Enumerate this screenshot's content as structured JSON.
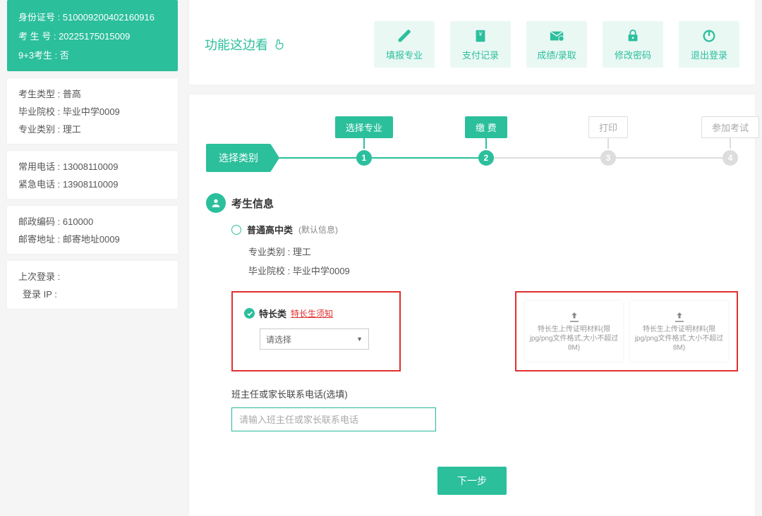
{
  "profile_card": {
    "id_label": "身份证号 :",
    "id_value": "510009200402160916",
    "exam_no_label": "考 生 号 :",
    "exam_no_value": "20225175015009",
    "nine_three_label": "9+3考生 :",
    "nine_three_value": "否"
  },
  "info1": {
    "type_label": "考生类型 :",
    "type_value": "普高",
    "school_label": "毕业院校 :",
    "school_value": "毕业中学0009",
    "cat_label": "专业类别 :",
    "cat_value": "理工"
  },
  "info2": {
    "phone_label": "常用电话 :",
    "phone_value": "13008110009",
    "emerg_label": "紧急电话 :",
    "emerg_value": "13908110009"
  },
  "info3": {
    "zip_label": "邮政编码 :",
    "zip_value": "610000",
    "addr_label": "邮寄地址 :",
    "addr_value": "邮寄地址0009"
  },
  "info4": {
    "last_login_label": "上次登录 :",
    "last_login_value": "",
    "login_ip_label": "登录 IP :",
    "login_ip_value": ""
  },
  "func": {
    "title": "功能这边看",
    "items": {
      "fill": "填报专业",
      "pay": "支付记录",
      "grade": "成绩/录取",
      "pwd": "修改密码",
      "logout": "退出登录"
    }
  },
  "steps": {
    "start": "选择类别",
    "s1_label": "选择专业",
    "s2_label": "缴  费",
    "s3_label": "打印",
    "s4_label": "参加考试",
    "n1": "1",
    "n2": "2",
    "n3": "3",
    "n4": "4"
  },
  "section": {
    "title": "考生信息",
    "radio_normal": "普通高中类",
    "radio_default_note": "(默认信息)",
    "cat_label": "专业类别 :",
    "cat_value": "理工",
    "school_label": "毕业院校 :",
    "school_value": "毕业中学0009"
  },
  "special": {
    "title": "特长类",
    "link": "特长生须知",
    "select_placeholder": "请选择",
    "upload_text": "特长生上传证明材料(限jpg/png文件格式,大小不超过8M)"
  },
  "contact": {
    "label": "班主任或家长联系电话(选填)",
    "placeholder": "请输入班主任或家长联系电话"
  },
  "buttons": {
    "next": "下一步"
  }
}
